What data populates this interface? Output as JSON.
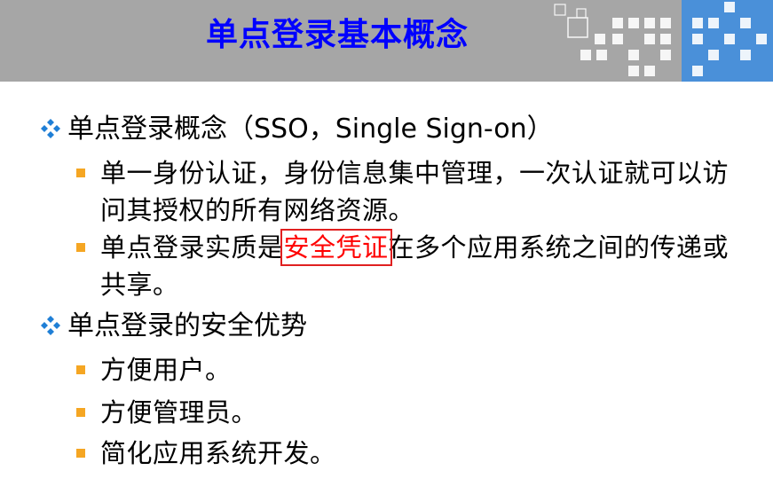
{
  "slide": {
    "title": "单点登录基本概念"
  },
  "sections": [
    {
      "heading": "单点登录概念（SSO，Single Sign-on）",
      "items": [
        {
          "text": "单一身份认证，身份信息集中管理，一次认证就可以访问其授权的所有网络资源。"
        },
        {
          "before": "单点登录实质是",
          "highlight": "安全凭证",
          "after": "在多个应用系统之间的传递或共享。"
        }
      ]
    },
    {
      "heading": "单点登录的安全优势",
      "items": [
        {
          "text": "方便用户。"
        },
        {
          "text": "方便管理员。"
        },
        {
          "text": "简化应用系统开发。"
        }
      ]
    }
  ],
  "colors": {
    "title": "#0000ff",
    "header_bg": "#a6a6a6",
    "bullet_diamond": "#1f7fd6",
    "bullet_square": "#f5a623",
    "highlight": "#ff0000"
  }
}
